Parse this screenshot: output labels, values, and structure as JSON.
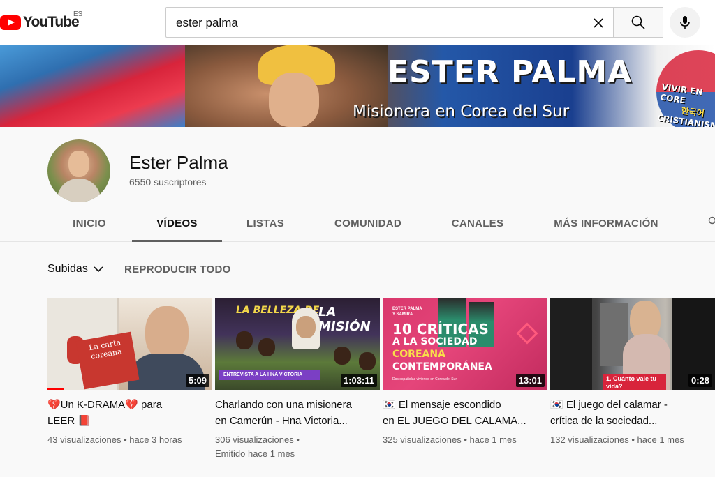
{
  "topbar": {
    "logo_text": "YouTube",
    "country": "ES",
    "search_value": "ester palma",
    "icons": [
      "youtube-logo",
      "clear-icon",
      "search-icon",
      "mic-icon"
    ]
  },
  "banner": {
    "title": "ESTER PALMA",
    "subtitle": "Misionera en Corea del Sur",
    "side_line1": "VIVIR EN CORE",
    "side_line2": "한국어",
    "side_line3": "CRISTIANISMO"
  },
  "channel": {
    "name": "Ester Palma",
    "subscribers": "6550 suscriptores"
  },
  "tabs": [
    "INICIO",
    "VÍDEOS",
    "LISTAS",
    "COMUNIDAD",
    "CANALES",
    "MÁS INFORMACIÓN"
  ],
  "active_tab": "VÍDEOS",
  "filters": {
    "sort_label": "Subidas",
    "play_all": "REPRODUCIR TODO"
  },
  "videos": [
    {
      "title_line1": "💔Un K-DRAMA💔 para",
      "title_line2": "LEER 📕",
      "duration": "5:09",
      "views": "43 visualizaciones",
      "age": "hace 3 horas",
      "thumb_text1": "La carta",
      "thumb_text2": "coreana"
    },
    {
      "title_line1": "Charlando con una misionera",
      "title_line2": "en Camerún - Hna Victoria...",
      "duration": "1:03:11",
      "views": "306 visualizaciones",
      "age": "Emitido hace 1 mes",
      "thumb_text1": "LA BELLEZA DE",
      "thumb_text2": "LA MISIÓN",
      "thumb_text3": "ENTREVISTA A LA HNA VICTORIA"
    },
    {
      "title_line1": "🇰🇷 El mensaje escondido",
      "title_line2": "en EL JUEGO DEL CALAMA...",
      "duration": "13:01",
      "views": "325 visualizaciones",
      "age": "hace 1 mes",
      "thumb_text1": "ESTER PALMA",
      "thumb_text2": "Y SAMIRA",
      "thumb_text3": "10 CRÍTICAS",
      "thumb_text4": "A LA SOCIEDAD",
      "thumb_text5": "COREANA",
      "thumb_text6": "CONTEMPORÁNEA",
      "thumb_text7": "Dos españolas viviendo en Corea del Sur"
    },
    {
      "title_line1": "🇰🇷 El juego del calamar -",
      "title_line2": "crítica de la sociedad...",
      "duration": "0:28",
      "views": "132 visualizaciones",
      "age": "hace 1 mes",
      "thumb_text1": "1. Cuánto vale tu",
      "thumb_text2": "vida?"
    }
  ]
}
